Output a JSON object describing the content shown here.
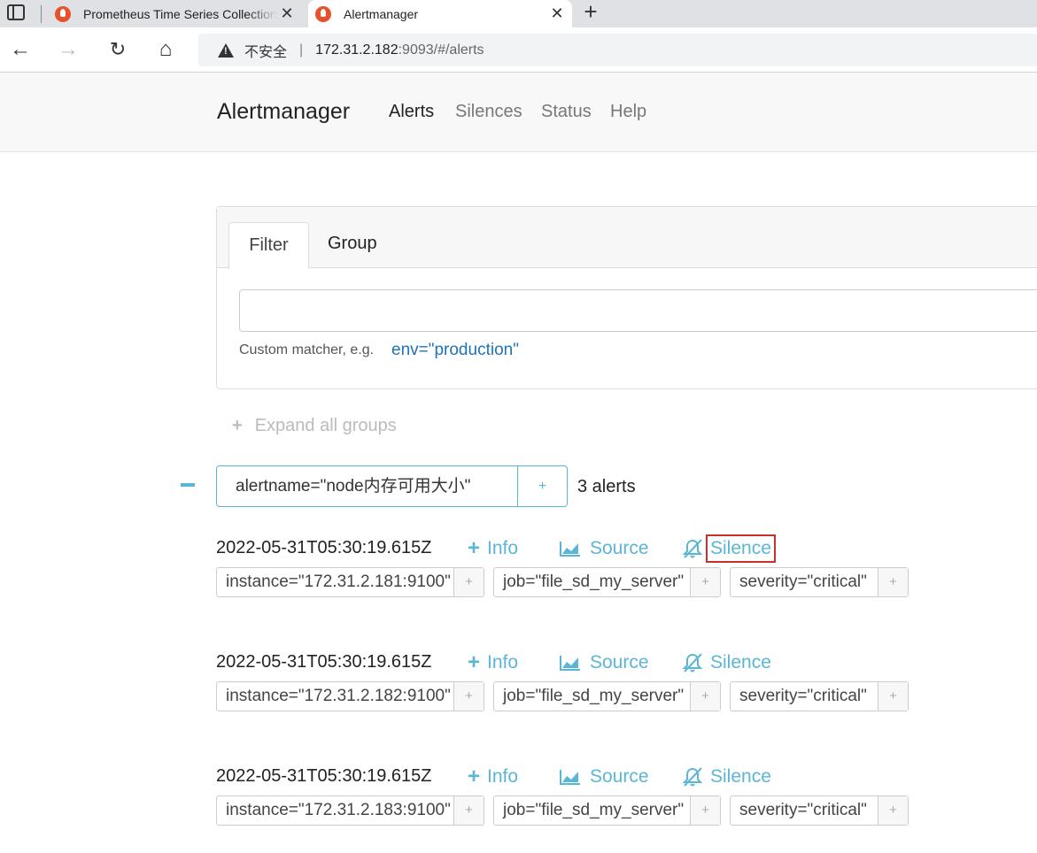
{
  "browser": {
    "tabs": [
      {
        "title": "Prometheus Time Series Collection and Processing Server",
        "close": "✕"
      },
      {
        "title": "Alertmanager",
        "close": "✕"
      }
    ],
    "new_tab": "+",
    "security_label": "不安全",
    "url_host": "172.31.2.182",
    "url_rest": ":9093/#/alerts"
  },
  "navbar": {
    "brand": "Alertmanager",
    "links": [
      "Alerts",
      "Silences",
      "Status",
      "Help"
    ]
  },
  "filter_card": {
    "tabs": [
      "Filter",
      "Group"
    ],
    "input_value": "",
    "hint": "Custom matcher, e.g.",
    "hint_example": "env=\"production\""
  },
  "expand_all": "Expand all groups",
  "group": {
    "label": "alertname=\"node内存可用大小\"",
    "add": "+",
    "count": "3 alerts"
  },
  "actions": {
    "info": "Info",
    "source": "Source",
    "silence": "Silence"
  },
  "alerts": [
    {
      "time": "2022-05-31T05:30:19.615Z",
      "labels": [
        "instance=\"172.31.2.181:9100\"",
        "job=\"file_sd_my_server\"",
        "severity=\"critical\""
      ]
    },
    {
      "time": "2022-05-31T05:30:19.615Z",
      "labels": [
        "instance=\"172.31.2.182:9100\"",
        "job=\"file_sd_my_server\"",
        "severity=\"critical\""
      ]
    },
    {
      "time": "2022-05-31T05:30:19.615Z",
      "labels": [
        "instance=\"172.31.2.183:9100\"",
        "job=\"file_sd_my_server\"",
        "severity=\"critical\""
      ]
    }
  ],
  "label_add": "+",
  "colors": {
    "accent": "#5bb6d6",
    "highlight_border": "#c9302c",
    "hint_code": "#1e73b8"
  }
}
